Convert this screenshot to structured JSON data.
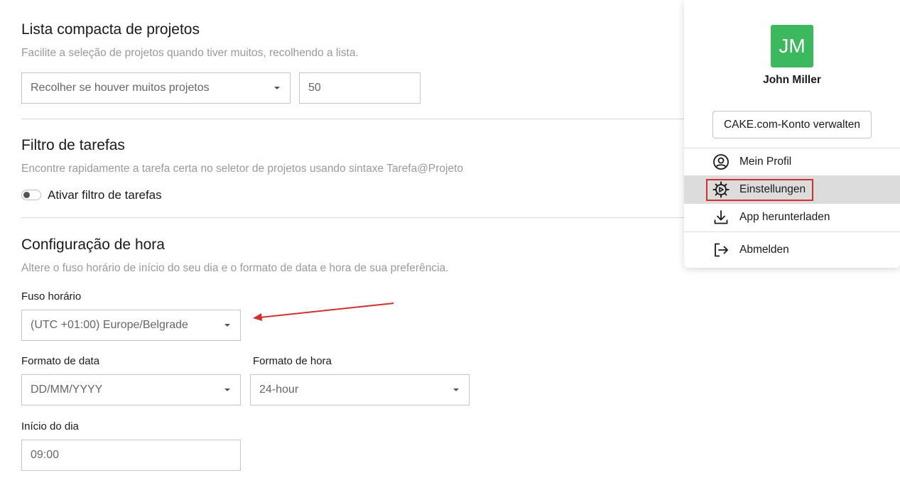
{
  "compact_list": {
    "title": "Lista compacta de projetos",
    "description": "Facilite a seleção de projetos quando tiver muitos, recolhendo a lista.",
    "select_value": "Recolher se houver muitos projetos",
    "count_value": "50"
  },
  "task_filter": {
    "title": "Filtro de tarefas",
    "description": "Encontre rapidamente a tarefa certa  no seletor de projetos usando sintaxe Tarefa@Projeto",
    "toggle_label": "Ativar filtro de tarefas",
    "toggle_on": false
  },
  "time_settings": {
    "title": "Configuração de hora",
    "description": "Altere o fuso horário de início do seu dia e o formato de data e hora de sua preferência.",
    "timezone_label": "Fuso horário",
    "timezone_value": "(UTC +01:00) Europe/Belgrade",
    "date_format_label": "Formato de data",
    "date_format_value": "DD/MM/YYYY",
    "time_format_label": "Formato de hora",
    "time_format_value": "24-hour",
    "day_start_label": "Início do dia",
    "day_start_value": "09:00"
  },
  "user_menu": {
    "avatar_initials": "JM",
    "avatar_color": "#3cb95f",
    "user_name": "John Miller",
    "manage_account_label": "CAKE.com-Konto verwalten",
    "items": [
      {
        "label": "Mein Profil",
        "icon": "user-circle-icon"
      },
      {
        "label": "Einstellungen",
        "icon": "gear-icon"
      },
      {
        "label": "App herunterladen",
        "icon": "download-icon"
      },
      {
        "label": "Abmelden",
        "icon": "logout-icon"
      }
    ]
  },
  "annotation_color": "#d32f2f"
}
